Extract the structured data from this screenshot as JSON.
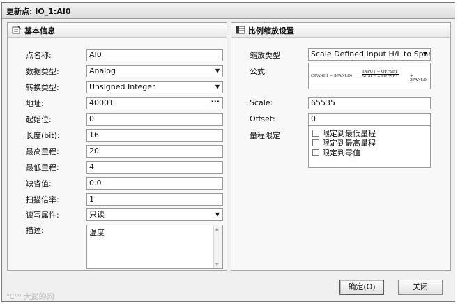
{
  "window": {
    "title": "更新点: IO_1:AI0"
  },
  "left_panel": {
    "title": "基本信息",
    "fields": {
      "name": {
        "label": "点名称:",
        "value": "AI0"
      },
      "data_type": {
        "label": "数据类型:",
        "value": "Analog"
      },
      "convert_type": {
        "label": "转换类型:",
        "value": "Unsigned Integer"
      },
      "address": {
        "label": "地址:",
        "value": "40001",
        "browse": "···"
      },
      "start_bit": {
        "label": "起始位:",
        "value": "0"
      },
      "length": {
        "label": "长度(bit):",
        "value": "16"
      },
      "max_range": {
        "label": "最高里程:",
        "value": "20"
      },
      "min_range": {
        "label": "最低里程:",
        "value": "4"
      },
      "default_value": {
        "label": "缺省值:",
        "value": "0.0"
      },
      "scan_rate": {
        "label": "扫描倍率:",
        "value": "1"
      },
      "rw_attr": {
        "label": "读写属性:",
        "value": "只读"
      },
      "description": {
        "label": "描述:",
        "value": "温度"
      }
    }
  },
  "right_panel": {
    "title": "比例缩放设置",
    "scaling_type": {
      "label": "缩放类型",
      "value": "Scale Defined Input H/L to Span"
    },
    "formula": {
      "label": "公式",
      "left": "(SPANHI − SPANLO)",
      "numerator": "INPUT − OFFSET",
      "denominator": "SCALE − OFFSET",
      "right": "+ SPANLO"
    },
    "scale": {
      "label": "Scale:",
      "value": "65535"
    },
    "offset": {
      "label": "Offset:",
      "value": "0"
    },
    "range_limit": {
      "label": "量程限定",
      "options": [
        "限定到最低量程",
        "限定到最高量程",
        "限定到零值"
      ]
    }
  },
  "buttons": {
    "ok": "确定(O)",
    "cancel": "关闭"
  },
  "watermark": "大武的网"
}
